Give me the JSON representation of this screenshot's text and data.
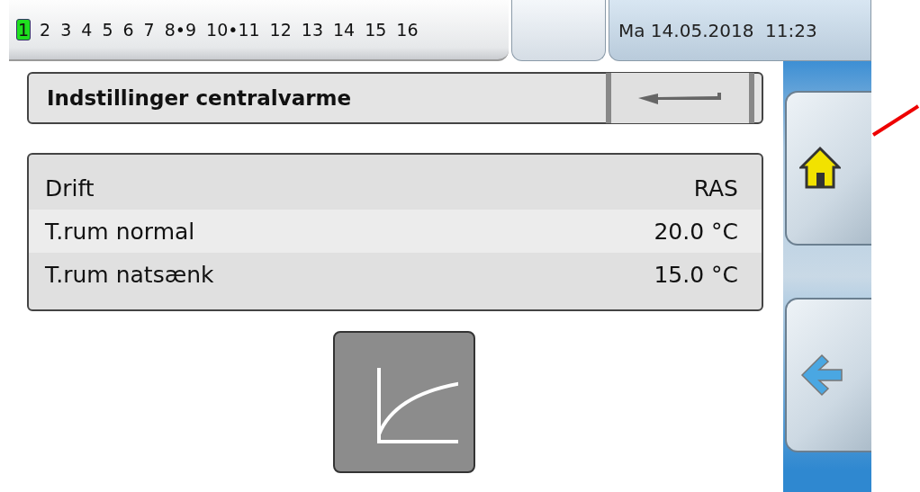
{
  "topbar": {
    "channels": [
      {
        "label": "1",
        "selected": true
      },
      {
        "label": "2",
        "selected": false
      },
      {
        "label": "3",
        "selected": false
      },
      {
        "label": "4",
        "selected": false
      },
      {
        "label": "5",
        "selected": false
      },
      {
        "label": "6",
        "selected": false
      },
      {
        "label": "7",
        "selected": false
      },
      {
        "label": "8•9",
        "selected": false
      },
      {
        "label": "10•11",
        "selected": false
      },
      {
        "label": "12",
        "selected": false
      },
      {
        "label": "13",
        "selected": false
      },
      {
        "label": "14",
        "selected": false
      },
      {
        "label": "15",
        "selected": false
      },
      {
        "label": "16",
        "selected": false
      }
    ],
    "datetime": "Ma 14.05.2018  11:23"
  },
  "title": "Indstillinger centralvarme",
  "settings": [
    {
      "label": "Drift",
      "value": "RAS"
    },
    {
      "label": "T.rum normal",
      "value": "20.0 °C"
    },
    {
      "label": "T.rum natsænk",
      "value": "15.0 °C"
    }
  ]
}
